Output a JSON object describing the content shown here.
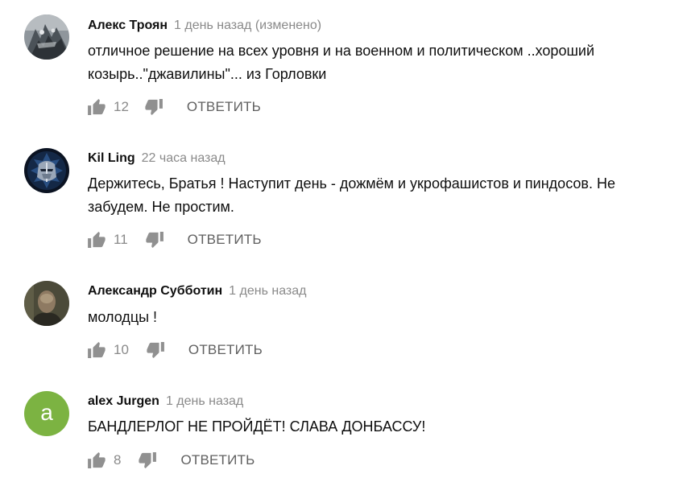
{
  "comments": [
    {
      "author": "Алекс Троян",
      "time": "1 день назад (изменено)",
      "text_lines": [
        "отличное решение на всех уровня и на военном и политическом ..хороший",
        "козырь..\"джавилины\"... из Горловки"
      ],
      "likes": "12",
      "reply_label": "ОТВЕТИТЬ",
      "avatar_type": "photo-gray"
    },
    {
      "author": "Kil Ling",
      "time": "22 часа назад",
      "text_lines": [
        "Держитесь, Братья ! Наступит день - дожмём и укрофашистов и пиндосов. Не",
        "забудем. Не простим."
      ],
      "likes": "11",
      "reply_label": "ОТВЕТИТЬ",
      "avatar_type": "knight-helmet"
    },
    {
      "author": "Александр Субботин",
      "time": "1 день назад",
      "text_lines": [
        "молодцы !"
      ],
      "likes": "10",
      "reply_label": "ОТВЕТИТЬ",
      "avatar_type": "photo-dark"
    },
    {
      "author": "alex Jurgen",
      "time": "1 день назад",
      "text_lines": [
        "БАНДЛЕРЛОГ НЕ ПРОЙДЁТ! СЛАВА ДОНБАССУ!"
      ],
      "likes": "8",
      "reply_label": "ОТВЕТИТЬ",
      "avatar_letter": "a",
      "avatar_color": "#7cb342"
    }
  ],
  "icons": {
    "like": "thumbs-up-icon",
    "dislike": "thumbs-down-icon"
  },
  "colors": {
    "author": "#0f0f0f",
    "meta": "#8a8a8a",
    "icon": "#909090",
    "reply": "#606060"
  }
}
